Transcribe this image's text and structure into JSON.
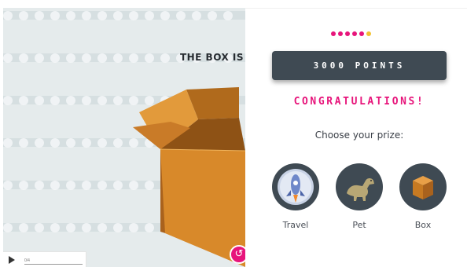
{
  "stage": {
    "heading": "THE BOX IS",
    "replay_icon": "↺"
  },
  "controls": {
    "label": "0/4"
  },
  "panel": {
    "progress_dots": [
      "#e7157b",
      "#e7157b",
      "#e7157b",
      "#e7157b",
      "#e7157b",
      "#f2c230"
    ],
    "points_label": "3000 POINTS",
    "congrats_text": "CONGRATULATIONS!",
    "choose_text": "Choose your prize:",
    "prizes": [
      {
        "label": "Travel",
        "icon": "rocket-icon"
      },
      {
        "label": "Pet",
        "icon": "dinosaur-icon"
      },
      {
        "label": "Box",
        "icon": "box-icon"
      }
    ]
  },
  "colors": {
    "accent": "#e7157b",
    "dark": "#3f4a53",
    "box": "#d8892a"
  }
}
